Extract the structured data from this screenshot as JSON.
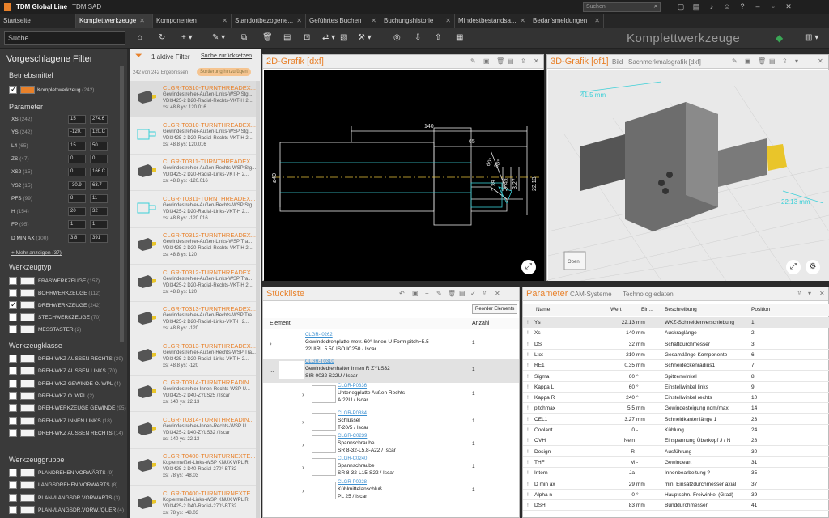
{
  "app": {
    "title": "TDM Global Line",
    "subtitle": "TDM SAD",
    "search_placeholder": "Suchen",
    "brand": "Komplettwerkzeuge"
  },
  "tabs": [
    "Startseite",
    "Komplettwerkzeuge",
    "Komponenten",
    "Standortbezogene...",
    "Geführtes Buchen",
    "Buchungshistorie",
    "Mindestbestandsa...",
    "Bedarfsmeldungen"
  ],
  "search": {
    "placeholder": "Suche"
  },
  "filter": {
    "title": "Vorgeschlagene Filter",
    "active": "1 aktive Filter",
    "reset": "Suche zurücksetzen",
    "results": "242 von 242 Ergebnissen",
    "sort": "Sortierung hinzufügen",
    "betrieb_title": "Betriebsmittel",
    "betrieb_item": "Komplettwerkzeug",
    "betrieb_count": "(242)",
    "param_title": "Parameter",
    "params": [
      {
        "name": "XS",
        "count": "(242)",
        "min": "15",
        "max": "274.6"
      },
      {
        "name": "YS",
        "count": "(242)",
        "min": "-120.",
        "max": "120.C"
      },
      {
        "name": "L4",
        "count": "(65)",
        "min": "15",
        "max": "50"
      },
      {
        "name": "ZS",
        "count": "(47)",
        "min": "0",
        "max": "0"
      },
      {
        "name": "XS2",
        "count": "(15)",
        "min": "0",
        "max": "166.C"
      },
      {
        "name": "YS2",
        "count": "(15)",
        "min": "-30.9",
        "max": "63.7"
      },
      {
        "name": "PFS",
        "count": "(99)",
        "min": "8",
        "max": "11"
      },
      {
        "name": "H",
        "count": "(154)",
        "min": "20",
        "max": "32"
      },
      {
        "name": "FP",
        "count": "(95)",
        "min": "1",
        "max": "1"
      },
      {
        "name": "D MIN AX",
        "count": "(100)",
        "min": "3.8",
        "max": "391"
      }
    ],
    "more": "+ Mehr anzeigen (37)",
    "typ_title": "Werkzeugtyp",
    "typ": [
      {
        "l": "FRÄSWERKZEUGE",
        "c": "(157)",
        "on": false
      },
      {
        "l": "BOHRWERKZEUGE",
        "c": "(112)",
        "on": false
      },
      {
        "l": "DREHWERKZEUGE",
        "c": "(242)",
        "on": true
      },
      {
        "l": "STECHWERKZEUGE",
        "c": "(70)",
        "on": false
      },
      {
        "l": "MESSTASTER",
        "c": "(2)",
        "on": false
      }
    ],
    "klasse_title": "Werkzeugklasse",
    "klasse": [
      {
        "l": "DREH-WKZ AUSSEN RECHTS",
        "c": "(29)"
      },
      {
        "l": "DREH-WKZ AUSSEN LINKS",
        "c": "(70)"
      },
      {
        "l": "DREH-WKZ GEWINDE O. WPL",
        "c": "(4)"
      },
      {
        "l": "DREH-WKZ O. WPL",
        "c": "(2)"
      },
      {
        "l": "DREH-WERKZEUGE GEWINDE",
        "c": "(95)"
      },
      {
        "l": "DREH-WKZ INNEN LINKS",
        "c": "(18)"
      },
      {
        "l": "DREH-WKZ AUSSEN RECHTS",
        "c": "(14)"
      }
    ],
    "gruppe_title": "Werkzeuggruppe",
    "gruppe": [
      {
        "l": "PLANDREHEN VORWÄRTS",
        "c": "(9)"
      },
      {
        "l": "LÄNGSDREHEN VORWÄRTS",
        "c": "(8)"
      },
      {
        "l": "PLAN-/LÄNGSDR.VORWÄRTS",
        "c": "(3)"
      },
      {
        "l": "PLAN-/LÄNGSDR.VORW./QUER",
        "c": "(4)"
      }
    ]
  },
  "results": [
    {
      "name": "CLGR-T0310-TURNTHREADEX...",
      "d1": "Gewindestrehler-Außen-Links-WSP Stg...",
      "d2": "VDI3425-2 D20-Radial-Rechts-VKT-H 2...",
      "d3": "xs: 48.8 ys: 120.016",
      "style": "dark"
    },
    {
      "name": "CLGR-T0310-TURNTHREADEX...",
      "d1": "Gewindestrehler-Außen-Links-WSP Stg...",
      "d2": "VDI3425-2 D20-Radial-Rechts-VKT-H 2...",
      "d3": "xs: 48.8 ys: 120.016",
      "style": "cyan"
    },
    {
      "name": "CLGR-T0311-TURNTHREADEX...",
      "d1": "Gewindestrehler-Außen-Rechts-WSP Stg...",
      "d2": "VDI3425-2 D20-Radial-Links-VKT-H 2...",
      "d3": "xs: 48.8 ys: -120.016",
      "style": "dark"
    },
    {
      "name": "CLGR-T0311-TURNTHREADEX...",
      "d1": "Gewindestrehler-Außen-Rechts-WSP Stg...",
      "d2": "VDI3425-2 D20-Radial-Links-VKT-H 2...",
      "d3": "xs: 48.8 ys: -120.016",
      "style": "cyan"
    },
    {
      "name": "CLGR-T0312-TURNTHREADEX...",
      "d1": "Gewindestrehler-Außen-Links-WSP Tra...",
      "d2": "VDI3425-2 D20-Radial-Rechts-VKT-H 2...",
      "d3": "xs: 48.8 ys: 120",
      "style": "dark"
    },
    {
      "name": "CLGR-T0312-TURNTHREADEX...",
      "d1": "Gewindestrehler-Außen-Links-WSP Tra...",
      "d2": "VDI3425-2 D20-Radial-Rechts-VKT-H 2...",
      "d3": "xs: 48.8 ys: 120",
      "style": "dark"
    },
    {
      "name": "CLGR-T0313-TURNTHREADEX...",
      "d1": "Gewindestrehler-Außen-Rechts-WSP Tra...",
      "d2": "VDI3425-2 D20-Radial-Links-VKT-H 2...",
      "d3": "xs: 48.8 ys: -120",
      "style": "dark"
    },
    {
      "name": "CLGR-T0313-TURNTHREADEX...",
      "d1": "Gewindestrehler-Außen-Rechts-WSP Tra...",
      "d2": "VDI3425-2 D20-Radial-Links-VKT-H 2...",
      "d3": "xs: 48.8 ys: -120",
      "style": "dark"
    },
    {
      "name": "CLGR-T0314-TURNTHREADIN...",
      "d1": "Gewindestrehler-Innen-Rechts-WSP U...",
      "d2": "VDI3425-2 D40-ZYLS25 / Iscar",
      "d3": "xs: 140 ys: 22.13",
      "style": "dark"
    },
    {
      "name": "CLGR-T0314-TURNTHREADIN...",
      "d1": "Gewindestrehler-Innen-Rechts-WSP U...",
      "d2": "VDI3425-2 D40-ZYLS32 / Iscar",
      "d3": "xs: 140 ys: 22.13",
      "style": "dark"
    },
    {
      "name": "CLGR-T0400-TURNTURNEXTE...",
      "d1": "Kopiermeißel-Links-WSP KNUX WPL R",
      "d2": "VDI3425-2 D40-Radial-270°-BT32",
      "d3": "xs: 78 ys: -48.03",
      "style": "dark"
    },
    {
      "name": "CLGR-T0400-TURNTURNEXTE...",
      "d1": "Kopiermeißel-Links-WSP KNUX WPL R",
      "d2": "VDI3425-2 D40-Radial-270°-BT32",
      "d3": "xs: 78 ys: -48.03",
      "style": "dark"
    }
  ],
  "grafik2d": {
    "title": "2D-Grafik [dxf]",
    "dims": {
      "d140": "140",
      "d65": "65",
      "d60": "60°",
      "d30": "30°",
      "d239": "2.39",
      "d293": "2.93",
      "d327": "3.27",
      "d2213": "22.13",
      "d40": "ø40"
    }
  },
  "grafik3d": {
    "title": "3D-Grafik [of1]",
    "tab2": "Bild",
    "tab3": "Sachmerkmalsgrafik [dxf]",
    "dim1": "41.5 mm",
    "dim2": "22.13 mm",
    "cube": "Oben"
  },
  "stueckliste": {
    "title": "Stückliste",
    "reorder": "Reorder Elements",
    "col_element": "Element",
    "col_anzahl": "Anzahl",
    "rows": [
      {
        "code": "CLGR-I0262",
        "l1": "Gewindedrehplatte metr. 60° Innen U-Form pitch=5.5",
        "l2": "22UIRL 5.50 ISO IC250 / Iscar",
        "n": "1",
        "level": 0
      },
      {
        "code": "CLGR-T0310",
        "l1": "Gewindedrehhalter Innen R ZYLS32",
        "l2": "SIR 0032 S22U / Iscar",
        "n": "1",
        "level": 0
      },
      {
        "code": "CLGR-P0336",
        "l1": "Unterlegplatte Außen Rechts",
        "l2": "AI22U / Iscar",
        "n": "1",
        "level": 1
      },
      {
        "code": "CLGR-P0384",
        "l1": "Schlüssel",
        "l2": "T-20/5 / Iscar",
        "n": "1",
        "level": 1
      },
      {
        "code": "CLGR-C0239",
        "l1": "Spannschraube",
        "l2": "SR 8-32-L5.8-A22 / Iscar",
        "n": "1",
        "level": 1
      },
      {
        "code": "CLGR-C0240",
        "l1": "Spannschraube",
        "l2": "SR 8-32-L15-S22 / Iscar",
        "n": "1",
        "level": 1
      },
      {
        "code": "CLGR-P0228",
        "l1": "Kühlmittelanschluß",
        "l2": "PL 25 / Iscar",
        "n": "1",
        "level": 1
      }
    ]
  },
  "parameter": {
    "title": "Parameter",
    "tab2": "CAM-Systeme",
    "tab3": "Technologiedaten",
    "cols": [
      "Name",
      "Wert",
      "Ein...",
      "Beschreibung",
      "Position"
    ],
    "rows": [
      [
        "Ys",
        "22.13",
        "mm",
        "WKZ-Schneidenverschiebung",
        "1"
      ],
      [
        "Xs",
        "140",
        "mm",
        "Auskraglänge",
        "2"
      ],
      [
        "DS",
        "32",
        "mm",
        "Schaftdurchmesser",
        "3"
      ],
      [
        "Ltot",
        "210",
        "mm",
        "Gesamtlänge Komponente",
        "6"
      ],
      [
        "RE1",
        "0.35",
        "mm",
        "Schneideckenradius1",
        "7"
      ],
      [
        "Sigma",
        "60",
        "°",
        "Spitzenwinkel",
        "8"
      ],
      [
        "Kappa L",
        "60",
        "°",
        "Einstellwinkel links",
        "9"
      ],
      [
        "Kappa R",
        "240",
        "°",
        "Einstellwinkel rechts",
        "10"
      ],
      [
        "pitchmax",
        "5.5",
        "mm",
        "Gewindesteigung nom/max",
        "14"
      ],
      [
        "CEL1",
        "3.27",
        "mm",
        "Schneidkantenlänge 1",
        "23"
      ],
      [
        "Coolant",
        "0",
        "-",
        "Kühlung",
        "24"
      ],
      [
        "OVH",
        "Nein",
        "",
        "Einspannung Überkopf J / N",
        "28"
      ],
      [
        "Design",
        "R",
        "-",
        "Ausführung",
        "30"
      ],
      [
        "THF",
        "M",
        "-",
        "Gewindeart",
        "31"
      ],
      [
        "Intern",
        "Ja",
        "",
        "Innenbearbeitung ?",
        "35"
      ],
      [
        "D min ax",
        "29",
        "mm",
        "min. Einsatzdurchmesser axial",
        "37"
      ],
      [
        "Alpha n",
        "0",
        "°",
        "Hauptschn.-Freiwinkel (Grad)",
        "39"
      ],
      [
        "DSH",
        "83",
        "mm",
        "Bunddurchmesser",
        "41"
      ]
    ]
  }
}
